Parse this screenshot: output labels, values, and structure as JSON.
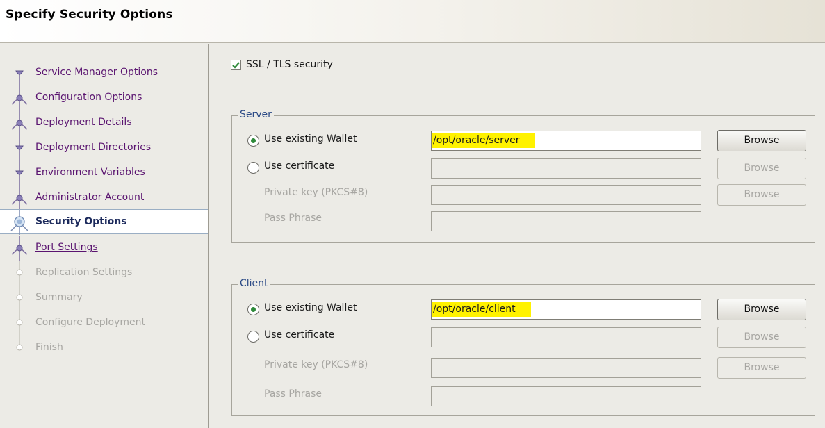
{
  "header": {
    "title": "Specify Security Options"
  },
  "sidebar": {
    "items": [
      {
        "label": "Service Manager Options",
        "state": "link"
      },
      {
        "label": "Configuration Options",
        "state": "link"
      },
      {
        "label": "Deployment Details",
        "state": "link"
      },
      {
        "label": "Deployment Directories",
        "state": "link"
      },
      {
        "label": "Environment Variables",
        "state": "link"
      },
      {
        "label": "Administrator Account",
        "state": "link"
      },
      {
        "label": "Security Options",
        "state": "current"
      },
      {
        "label": "Port Settings",
        "state": "link"
      },
      {
        "label": "Replication Settings",
        "state": "disabled"
      },
      {
        "label": "Summary",
        "state": "disabled"
      },
      {
        "label": "Configure Deployment",
        "state": "disabled"
      },
      {
        "label": "Finish",
        "state": "disabled"
      }
    ]
  },
  "ssl": {
    "label": "SSL / TLS security",
    "checked": true
  },
  "server": {
    "legend": "Server",
    "wallet_label": "Use existing Wallet",
    "wallet_path": "/opt/oracle/server",
    "wallet_browse": "Browse",
    "cert_label": "Use certificate",
    "cert_browse": "Browse",
    "key_label": "Private key (PKCS#8)",
    "key_browse": "Browse",
    "pass_label": "Pass Phrase"
  },
  "client": {
    "legend": "Client",
    "wallet_label": "Use existing Wallet",
    "wallet_path": "/opt/oracle/client",
    "wallet_browse": "Browse",
    "cert_label": "Use certificate",
    "cert_browse": "Browse",
    "key_label": "Private key (PKCS#8)",
    "key_browse": "Browse",
    "pass_label": "Pass Phrase"
  },
  "colors": {
    "link": "#5a1470",
    "current_text": "#1c2a5c",
    "highlight": "#fff200",
    "check_green": "#2e8a3a",
    "legend_blue": "#2b4a86"
  }
}
